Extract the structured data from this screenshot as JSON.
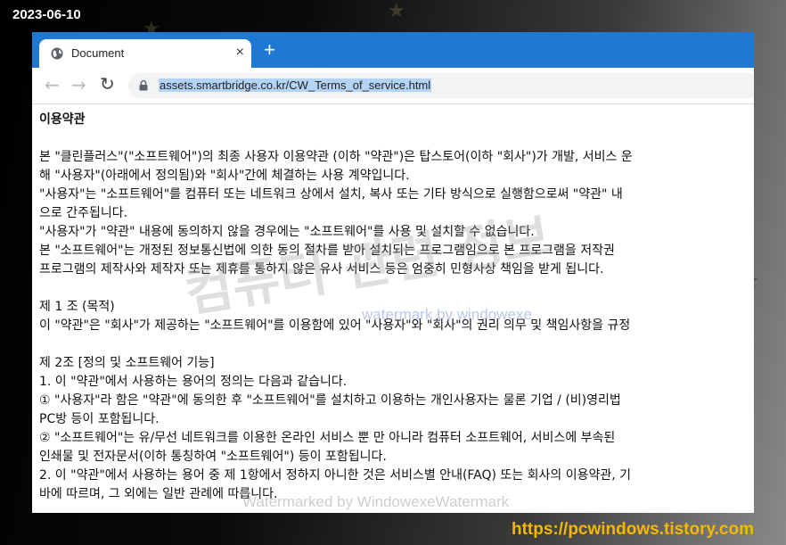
{
  "overlay": {
    "date": "2023-06-10",
    "site": "https://pcwindows.tistory.com",
    "watermark_big": "컴퓨터 관련 정보",
    "watermark_small": "watermark by windowexe",
    "watermark_bottom": "Watermarked by WindowexeWatermark"
  },
  "browser": {
    "tab_title": "Document",
    "tab_close": "×",
    "new_tab": "+",
    "url": "assets.smartbridge.co.kr/CW_Terms_of_service.html"
  },
  "page": {
    "lines": [
      {
        "text": "이용약관",
        "style": "heading"
      },
      {
        "text": "",
        "style": "blank"
      },
      {
        "text": "본 \"클린플러스\"(\"소프트웨어\")의 최종 사용자 이용약관 (이하 \"약관\")은 탑스토어(이하 \"회사\")가 개발, 서비스 운",
        "style": "line"
      },
      {
        "text": "해 \"사용자\"(아래에서 정의됨)와 \"회사\"간에 체결하는 사용 계약입니다.",
        "style": "line"
      },
      {
        "text": "\"사용자\"는 \"소프트웨어\"를 컴퓨터 또는 네트워크 상에서 설치, 복사 또는 기타 방식으로 실행함으로써 \"약관\" 내",
        "style": "line"
      },
      {
        "text": "으로 간주됩니다.",
        "style": "line"
      },
      {
        "text": "\"사용자\"가 \"약관\" 내용에 동의하지 않을 경우에는 \"소프트웨어\"를 사용 및 설치할 수 없습니다.",
        "style": "line"
      },
      {
        "text": "본 \"소프트웨어\"는 개정된 정보통신법에 의한 동의 절차를 받아 설치되는 프로그램임으로 본 프로그램을 저작권",
        "style": "line"
      },
      {
        "text": "프로그램의 제작사와 제작자 또는 제휴를 통하지 않은 유사 서비스 등은 엄중히 민형사상 책임을 받게 됩니다.",
        "style": "line"
      },
      {
        "text": "",
        "style": "blank"
      },
      {
        "text": "제 1 조 (목적)",
        "style": "line"
      },
      {
        "text": "이 \"약관\"은 \"회사\"가 제공하는 \"소프트웨어\"를 이용함에 있어 \"사용자\"와 \"회사\"의 권리 의무 및 책임사항을 규정",
        "style": "line"
      },
      {
        "text": "",
        "style": "blank"
      },
      {
        "text": "제 2조 [정의 및 소프트웨어 기능]",
        "style": "line"
      },
      {
        "text": "1. 이 \"약관\"에서 사용하는 용어의 정의는 다음과 같습니다.",
        "style": "line"
      },
      {
        "text": "① \"사용자\"라 함은 \"약관\"에 동의한 후 \"소프트웨어\"를 설치하고 이용하는 개인사용자는 물론 기업 / (비)영리법",
        "style": "line"
      },
      {
        "text": "PC방 등이 포함됩니다.",
        "style": "line"
      },
      {
        "text": "② \"소프트웨어\"는 유/무선 네트워크를 이용한 온라인 서비스 뿐 만 아니라 컴퓨터 소프트웨어, 서비스에 부속된",
        "style": "line"
      },
      {
        "text": "인쇄물 및 전자문서(이하 통칭하여 \"소프트웨어\") 등이 포함됩니다.",
        "style": "line"
      },
      {
        "text": "2. 이 \"약관\"에서 사용하는 용어 중 제 1항에서 정하지 아니한 것은 서비스별 안내(FAQ) 또는 회사의 이용약관, 기",
        "style": "line"
      },
      {
        "text": "바에 따르며, 그 외에는 일반 관례에 따릅니다.",
        "style": "line"
      }
    ]
  }
}
